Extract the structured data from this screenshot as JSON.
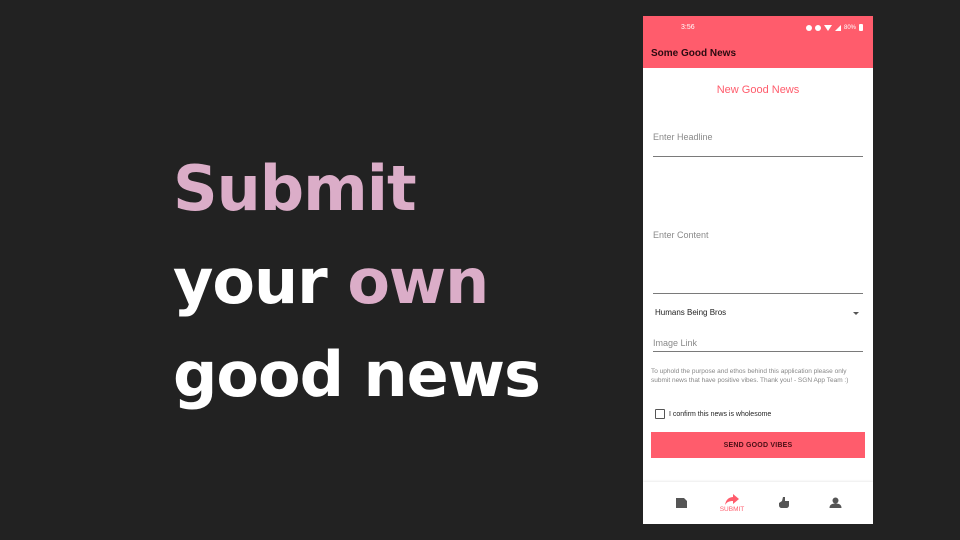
{
  "slide": {
    "line1": "Submit",
    "line2_plain": "your ",
    "line2_accent": "own",
    "line3": "good news"
  },
  "colors": {
    "background": "#222222",
    "accent_pink": "#dbadc8",
    "brand": "#ff5c6c"
  },
  "status_bar": {
    "time": "3:56",
    "battery": "80%"
  },
  "app": {
    "title": "Some Good News"
  },
  "form": {
    "title": "New Good News",
    "headline_placeholder": "Enter Headline",
    "content_placeholder": "Enter Content",
    "category_selected": "Humans Being Bros",
    "image_link_placeholder": "Image Link",
    "disclaimer": "To uphold the purpose and ethos behind this application please only submit news that have positive vibes. Thank you! - SGN App Team :)",
    "confirm_label": "I confirm this news is wholesome",
    "submit_label": "SEND GOOD VIBES"
  },
  "bottom_nav": {
    "items": [
      {
        "icon": "news-icon",
        "label": ""
      },
      {
        "icon": "share-icon",
        "label": "SUBMIT"
      },
      {
        "icon": "thumbs-up-icon",
        "label": ""
      },
      {
        "icon": "profile-icon",
        "label": ""
      }
    ]
  }
}
